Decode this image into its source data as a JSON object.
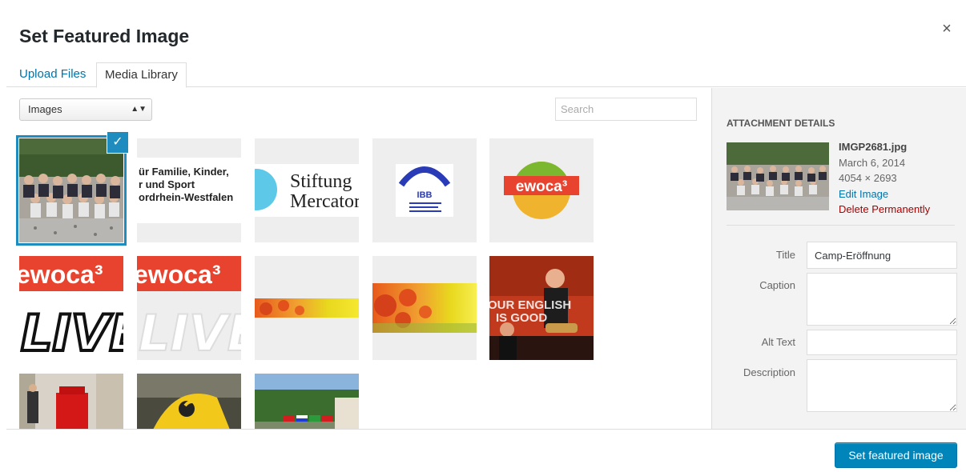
{
  "modal": {
    "title": "Set Featured Image",
    "close_label": "×"
  },
  "tabs": [
    {
      "label": "Upload Files",
      "active": false
    },
    {
      "label": "Media Library",
      "active": true
    }
  ],
  "toolbar": {
    "filter_selected": "Images",
    "search_placeholder": "Search"
  },
  "grid": {
    "items": [
      {
        "name": "group-photo",
        "text": []
      },
      {
        "name": "familie-kinder-logo",
        "text": [
          "ür Familie, Kinder,",
          "r und Sport",
          "ordrhein-Westfalen"
        ]
      },
      {
        "name": "stiftung-mercator-logo",
        "text": [
          "Stiftung",
          "Mercator"
        ]
      },
      {
        "name": "ibb-logo",
        "text": [
          "IBB"
        ]
      },
      {
        "name": "ewoca-logo",
        "text": [
          "ewoca³"
        ]
      },
      {
        "name": "ewoca-live-dark",
        "text": [
          "ewoca³",
          "LIVE"
        ]
      },
      {
        "name": "ewoca-live-light",
        "text": [
          "ewoca³",
          "LIVE"
        ]
      },
      {
        "name": "flower-banner-thin",
        "text": []
      },
      {
        "name": "flower-banner",
        "text": []
      },
      {
        "name": "concert-photo",
        "text": [
          "OUR ENGLISH",
          "IS GOOD"
        ]
      },
      {
        "name": "street-photo",
        "text": []
      },
      {
        "name": "yellow-person-photo",
        "text": []
      },
      {
        "name": "flags-photo",
        "text": []
      }
    ],
    "selected_check": "✓"
  },
  "attachment": {
    "heading": "ATTACHMENT DETAILS",
    "filename": "IMGP2681.jpg",
    "date": "March 6, 2014",
    "dimensions": "4054 × 2693",
    "edit_link": "Edit Image",
    "delete_link": "Delete Permanently",
    "fields": {
      "title_label": "Title",
      "title_value": "Camp-Eröffnung",
      "caption_label": "Caption",
      "caption_value": "",
      "alt_label": "Alt Text",
      "alt_value": "",
      "description_label": "Description",
      "description_value": ""
    }
  },
  "footer": {
    "primary_button": "Set featured image"
  },
  "colors": {
    "accent": "#0073aa",
    "primary_button": "#0085ba",
    "delete": "#aa0000",
    "selection": "#1e8cbe",
    "ewoca_red": "#e8432e",
    "ewoca_green": "#7cb82f"
  }
}
